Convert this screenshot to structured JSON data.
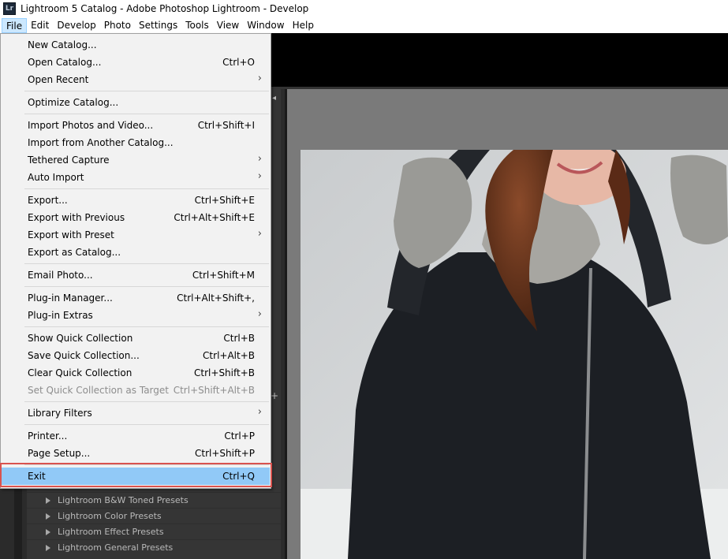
{
  "window": {
    "icon_text": "Lr",
    "title": "Lightroom 5 Catalog - Adobe Photoshop Lightroom - Develop"
  },
  "menubar": [
    "File",
    "Edit",
    "Develop",
    "Photo",
    "Settings",
    "Tools",
    "View",
    "Window",
    "Help"
  ],
  "file_menu": {
    "items": [
      {
        "label": "New Catalog...",
        "shortcut": "",
        "submenu": false,
        "disabled": false
      },
      {
        "label": "Open Catalog...",
        "shortcut": "Ctrl+O",
        "submenu": false,
        "disabled": false
      },
      {
        "label": "Open Recent",
        "shortcut": "",
        "submenu": true,
        "disabled": false
      },
      {
        "label": "Optimize Catalog...",
        "shortcut": "",
        "submenu": false,
        "disabled": false
      },
      {
        "label": "Import Photos and Video...",
        "shortcut": "Ctrl+Shift+I",
        "submenu": false,
        "disabled": false
      },
      {
        "label": "Import from Another Catalog...",
        "shortcut": "",
        "submenu": false,
        "disabled": false
      },
      {
        "label": "Tethered Capture",
        "shortcut": "",
        "submenu": true,
        "disabled": false
      },
      {
        "label": "Auto Import",
        "shortcut": "",
        "submenu": true,
        "disabled": false
      },
      {
        "label": "Export...",
        "shortcut": "Ctrl+Shift+E",
        "submenu": false,
        "disabled": false
      },
      {
        "label": "Export with Previous",
        "shortcut": "Ctrl+Alt+Shift+E",
        "submenu": false,
        "disabled": false
      },
      {
        "label": "Export with Preset",
        "shortcut": "",
        "submenu": true,
        "disabled": false
      },
      {
        "label": "Export as Catalog...",
        "shortcut": "",
        "submenu": false,
        "disabled": false
      },
      {
        "label": "Email Photo...",
        "shortcut": "Ctrl+Shift+M",
        "submenu": false,
        "disabled": false
      },
      {
        "label": "Plug-in Manager...",
        "shortcut": "Ctrl+Alt+Shift+,",
        "submenu": false,
        "disabled": false
      },
      {
        "label": "Plug-in Extras",
        "shortcut": "",
        "submenu": true,
        "disabled": false
      },
      {
        "label": "Show Quick Collection",
        "shortcut": "Ctrl+B",
        "submenu": false,
        "disabled": false
      },
      {
        "label": "Save Quick Collection...",
        "shortcut": "Ctrl+Alt+B",
        "submenu": false,
        "disabled": false
      },
      {
        "label": "Clear Quick Collection",
        "shortcut": "Ctrl+Shift+B",
        "submenu": false,
        "disabled": false
      },
      {
        "label": "Set Quick Collection as Target",
        "shortcut": "Ctrl+Shift+Alt+B",
        "submenu": false,
        "disabled": true
      },
      {
        "label": "Library Filters",
        "shortcut": "",
        "submenu": true,
        "disabled": false
      },
      {
        "label": "Printer...",
        "shortcut": "Ctrl+P",
        "submenu": false,
        "disabled": false
      },
      {
        "label": "Page Setup...",
        "shortcut": "Ctrl+Shift+P",
        "submenu": false,
        "disabled": false
      },
      {
        "label": "Exit",
        "shortcut": "Ctrl+Q",
        "submenu": false,
        "disabled": false,
        "highlighted": true
      }
    ]
  },
  "presets": [
    "Lightroom B&W Toned Presets",
    "Lightroom Color Presets",
    "Lightroom Effect Presets",
    "Lightroom General Presets"
  ],
  "colors": {
    "highlight": "#91c9f7",
    "annotation": "#d9534f",
    "menu_bg": "#f2f2f2"
  },
  "icons": {
    "submenu_arrow": "chevron-right-icon",
    "preset_toggle": "triangle-right-icon",
    "panel_add": "plus-icon"
  },
  "panel": {
    "add_glyph": "+"
  }
}
